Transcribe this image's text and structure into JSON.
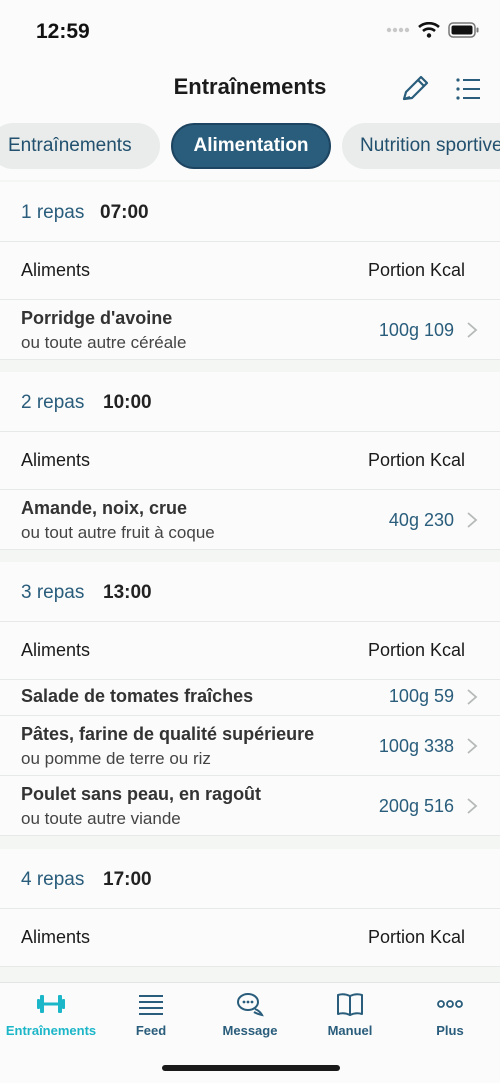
{
  "status": {
    "time": "12:59"
  },
  "header": {
    "title": "Entraînements"
  },
  "tabs": [
    {
      "label": "Entraînements"
    },
    {
      "label": "Alimentation"
    },
    {
      "label": "Nutrition sportive"
    }
  ],
  "columns": {
    "left": "Aliments",
    "right": "Portion Kcal"
  },
  "meals": [
    {
      "num": "1 repas",
      "time": "07:00",
      "items": [
        {
          "name": "Porridge d'avoine",
          "sub": "ou toute autre céréale",
          "value": "100g 109"
        }
      ]
    },
    {
      "num": "2 repas",
      "time": "10:00",
      "items": [
        {
          "name": "Amande, noix, crue",
          "sub": "ou tout autre fruit à coque",
          "value": "40g 230"
        }
      ]
    },
    {
      "num": "3 repas",
      "time": "13:00",
      "items": [
        {
          "name": "Salade de tomates fraîches",
          "sub": "",
          "value": "100g 59"
        },
        {
          "name": "Pâtes, farine de qualité supérieure",
          "sub": "ou pomme de terre ou riz",
          "value": "100g 338"
        },
        {
          "name": "Poulet sans peau, en ragoût",
          "sub": "ou toute autre viande",
          "value": "200g 516"
        }
      ]
    },
    {
      "num": "4 repas",
      "time": "17:00",
      "items": []
    }
  ],
  "tabbar": [
    {
      "label": "Entraînements",
      "icon": "dumbbell-icon"
    },
    {
      "label": "Feed",
      "icon": "feed-lines-icon"
    },
    {
      "label": "Message",
      "icon": "chat-bubbles-icon"
    },
    {
      "label": "Manuel",
      "icon": "book-icon"
    },
    {
      "label": "Plus",
      "icon": "more-dots-icon"
    }
  ],
  "colors": {
    "accent": "#2a5d7c",
    "active_tab": "#1cb6c9",
    "background": "#f4f6f4"
  }
}
